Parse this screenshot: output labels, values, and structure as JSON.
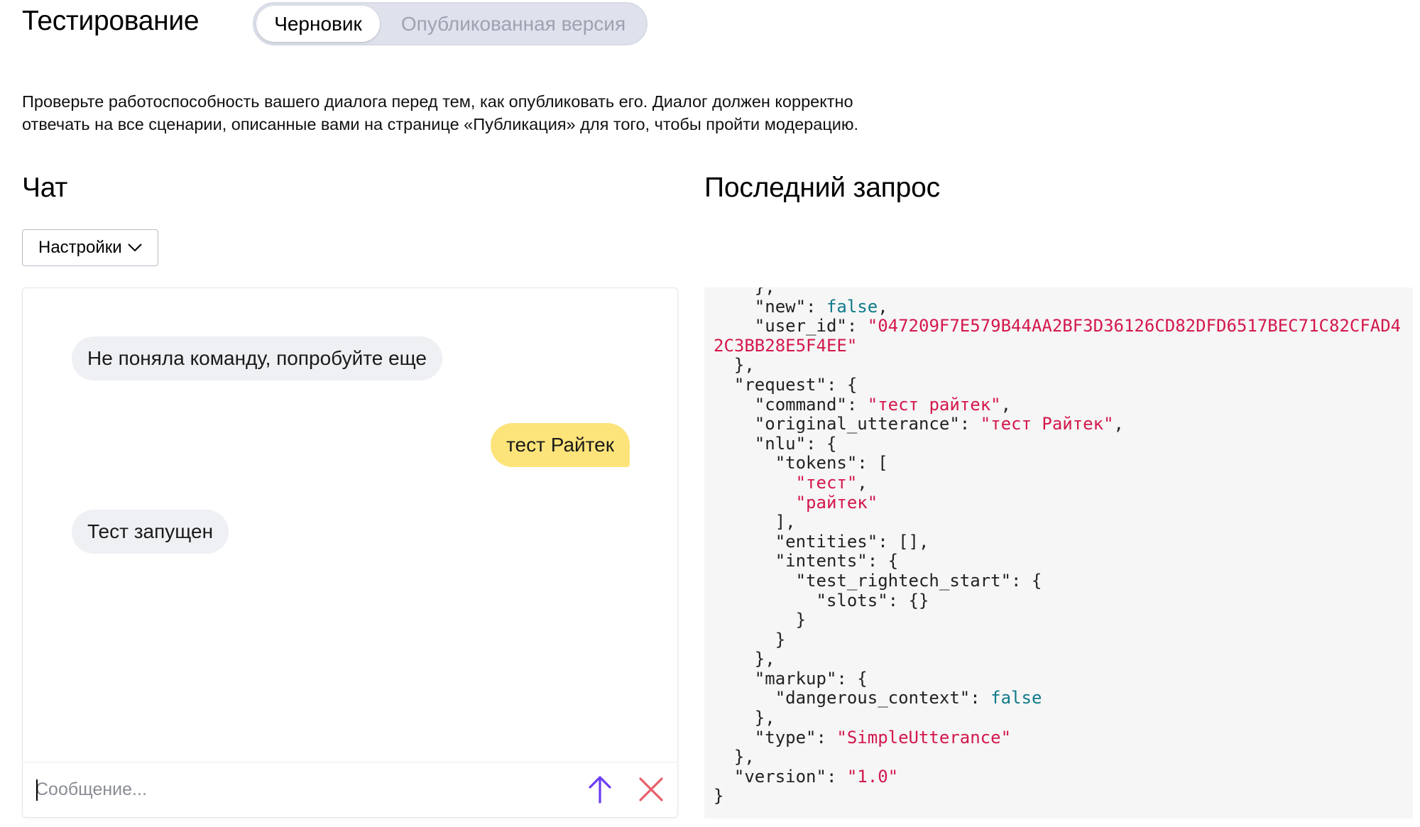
{
  "header": {
    "title": "Тестирование",
    "mode_switch": {
      "active": "Черновик",
      "inactive": "Опубликованная версия"
    }
  },
  "description": {
    "line1": "Проверьте работоспособность вашего диалога перед тем, как опубликовать его. Диалог должен корректно",
    "line2": "отвечать на все сценарии, описанные вами на странице «Публикация» для того, чтобы пройти модерацию."
  },
  "chat": {
    "title": "Чат",
    "settings_label": "Настройки",
    "messages": [
      {
        "from": "bot",
        "text": "Не поняла команду, попробуйте еще"
      },
      {
        "from": "user",
        "text": "тест Райтек"
      },
      {
        "from": "bot",
        "text": "Тест запущен"
      }
    ],
    "input": {
      "placeholder": "Сообщение...",
      "value": ""
    }
  },
  "last_request": {
    "title": "Последний запрос",
    "lines": [
      [
        {
          "t": "    },",
          "c": "p"
        }
      ],
      [
        {
          "t": "    \"new\": ",
          "c": "p"
        },
        {
          "t": "false",
          "c": "kw"
        },
        {
          "t": ",",
          "c": "p"
        }
      ],
      [
        {
          "t": "    \"user_id\": ",
          "c": "p"
        },
        {
          "t": "\"047209F7E579B44AA2BF3D36126CD82DFD6517BEC71C82CFAD4",
          "c": "str"
        }
      ],
      [
        {
          "t": "2C3BB28E5F4EE\"",
          "c": "str"
        }
      ],
      [
        {
          "t": "  },",
          "c": "p"
        }
      ],
      [
        {
          "t": "  \"request\": {",
          "c": "p"
        }
      ],
      [
        {
          "t": "    \"command\": ",
          "c": "p"
        },
        {
          "t": "\"тест райтек\"",
          "c": "str"
        },
        {
          "t": ",",
          "c": "p"
        }
      ],
      [
        {
          "t": "    \"original_utterance\": ",
          "c": "p"
        },
        {
          "t": "\"тест Райтек\"",
          "c": "str"
        },
        {
          "t": ",",
          "c": "p"
        }
      ],
      [
        {
          "t": "    \"nlu\": {",
          "c": "p"
        }
      ],
      [
        {
          "t": "      \"tokens\": [",
          "c": "p"
        }
      ],
      [
        {
          "t": "        ",
          "c": "p"
        },
        {
          "t": "\"тест\"",
          "c": "str"
        },
        {
          "t": ",",
          "c": "p"
        }
      ],
      [
        {
          "t": "        ",
          "c": "p"
        },
        {
          "t": "\"райтек\"",
          "c": "str"
        }
      ],
      [
        {
          "t": "      ],",
          "c": "p"
        }
      ],
      [
        {
          "t": "      \"entities\": [],",
          "c": "p"
        }
      ],
      [
        {
          "t": "      \"intents\": {",
          "c": "p"
        }
      ],
      [
        {
          "t": "        \"test_rightech_start\": {",
          "c": "p"
        }
      ],
      [
        {
          "t": "          \"slots\": {}",
          "c": "p"
        }
      ],
      [
        {
          "t": "        }",
          "c": "p"
        }
      ],
      [
        {
          "t": "      }",
          "c": "p"
        }
      ],
      [
        {
          "t": "    },",
          "c": "p"
        }
      ],
      [
        {
          "t": "    \"markup\": {",
          "c": "p"
        }
      ],
      [
        {
          "t": "      \"dangerous_context\": ",
          "c": "p"
        },
        {
          "t": "false",
          "c": "kw"
        }
      ],
      [
        {
          "t": "    },",
          "c": "p"
        }
      ],
      [
        {
          "t": "    \"type\": ",
          "c": "p"
        },
        {
          "t": "\"SimpleUtterance\"",
          "c": "str"
        }
      ],
      [
        {
          "t": "  },",
          "c": "p"
        }
      ],
      [
        {
          "t": "  \"version\": ",
          "c": "p"
        },
        {
          "t": "\"1.0\"",
          "c": "str"
        }
      ],
      [
        {
          "t": "}",
          "c": "p"
        }
      ]
    ]
  },
  "colors": {
    "user_bubble": "#fde47a",
    "bot_bubble": "#eff0f4",
    "send_icon": "#6c3bf5",
    "clear_icon": "#e5606a",
    "json_string": "#d3184c",
    "json_keyword": "#0f7a8a"
  }
}
